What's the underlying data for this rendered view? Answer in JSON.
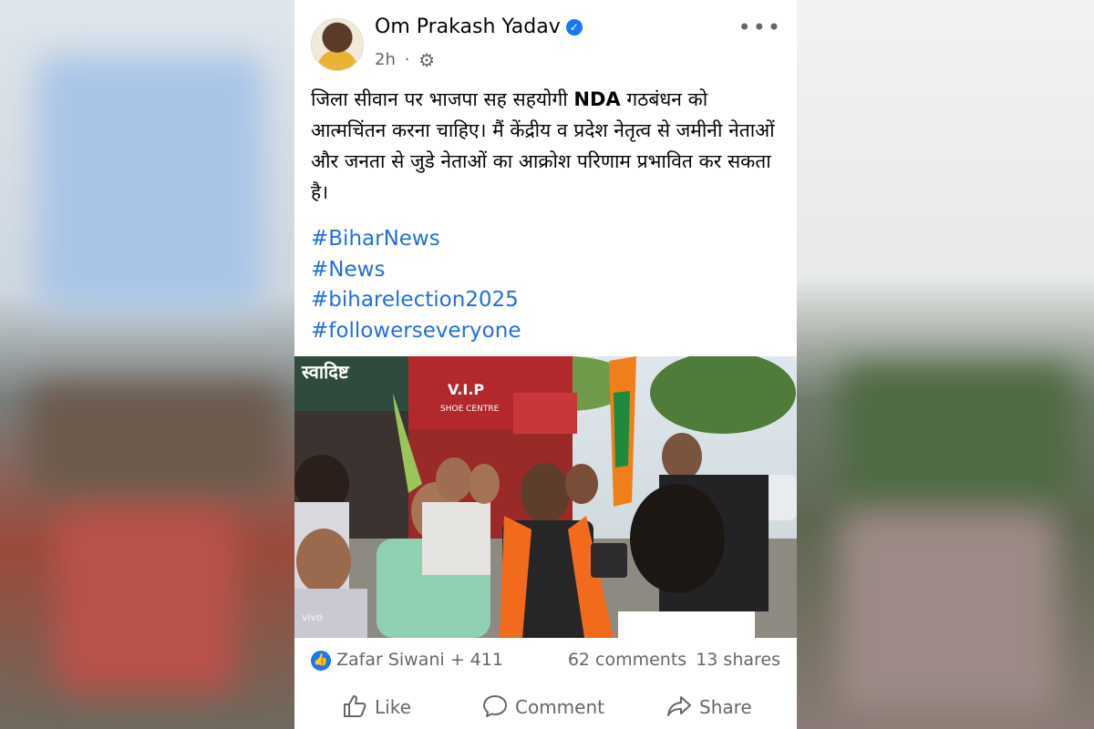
{
  "post": {
    "author": "Om Prakash Yadav",
    "time": "2h",
    "separator": "·",
    "body": {
      "part1": "जिला सीवान पर भाजपा सह सहयोगी ",
      "bold": "NDA",
      "part2": " गठबंधन को आत्मचिंतन करना चाहिए। मैं केंद्रीय व प्रदेश नेतृत्व से जमीनी नेताओं और जनता से जुडे नेताओं का आक्रोश परिणाम प्रभावित कर सकता है।"
    },
    "hashtags": [
      "#BiharNews",
      "#News",
      "#biharelection2025",
      "#followerseveryone"
    ],
    "photo": {
      "shop_sign": "V.I.P",
      "shop_sub": "SHOE CENTRE",
      "hindi_sign": "स्वादिष्ट",
      "watermark": "vivo"
    },
    "reactions": {
      "reactors": "Zafar Siwani + 411",
      "comments": "62 comments",
      "shares": "13 shares"
    },
    "actions": {
      "like": "Like",
      "comment": "Comment",
      "share": "Share"
    }
  },
  "colors": {
    "link": "#216fdb",
    "meta": "#65676b",
    "brand": "#1877f2"
  },
  "icons": {
    "verified": "verified-check-icon",
    "audience": "gear-icon",
    "more": "more-dots-icon",
    "like": "thumbs-up-icon",
    "comment": "comment-bubble-icon",
    "share": "share-arrow-icon"
  }
}
